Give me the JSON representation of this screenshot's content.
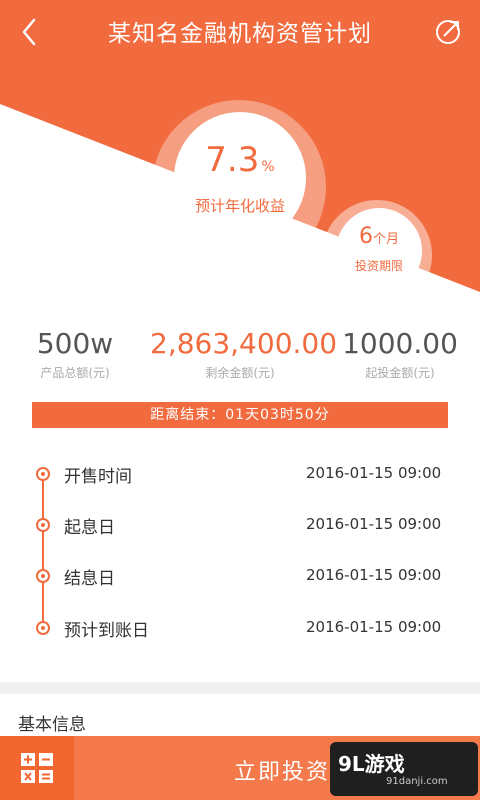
{
  "header": {
    "title": "某知名金融机构资管计划",
    "back_icon": "back-chevron-icon",
    "share_icon": "share-icon"
  },
  "hero": {
    "rate_value": "7.3",
    "rate_unit": "%",
    "rate_label": "预计年化收益",
    "period_value": "6",
    "period_unit": "个月",
    "period_label": "投资期限"
  },
  "stats": {
    "total_value": "500w",
    "total_label": "产品总额(元)",
    "remaining_value": "2,863,400.00",
    "remaining_label": "剩余金额(元)",
    "min_value": "1000.00",
    "min_label": "起投金额(元)"
  },
  "countdown": {
    "text": "距离结束：01天03时50分"
  },
  "timeline": [
    {
      "label": "开售时间",
      "date": "2016-01-15  09:00"
    },
    {
      "label": "起息日",
      "date": "2016-01-15  09:00"
    },
    {
      "label": "结息日",
      "date": "2016-01-15  09:00"
    },
    {
      "label": "预计到账日",
      "date": "2016-01-15  09:00"
    }
  ],
  "section": {
    "basic_info": "基本信息"
  },
  "bottom": {
    "invest_label": "立即投资",
    "calculator_icon": "calculator-icon"
  },
  "watermark": {
    "logo": "9L游戏",
    "site": "91danji.com"
  },
  "colors": {
    "accent": "#f26b3e",
    "button": "#f47a4c",
    "button_dark": "#f2672f"
  }
}
